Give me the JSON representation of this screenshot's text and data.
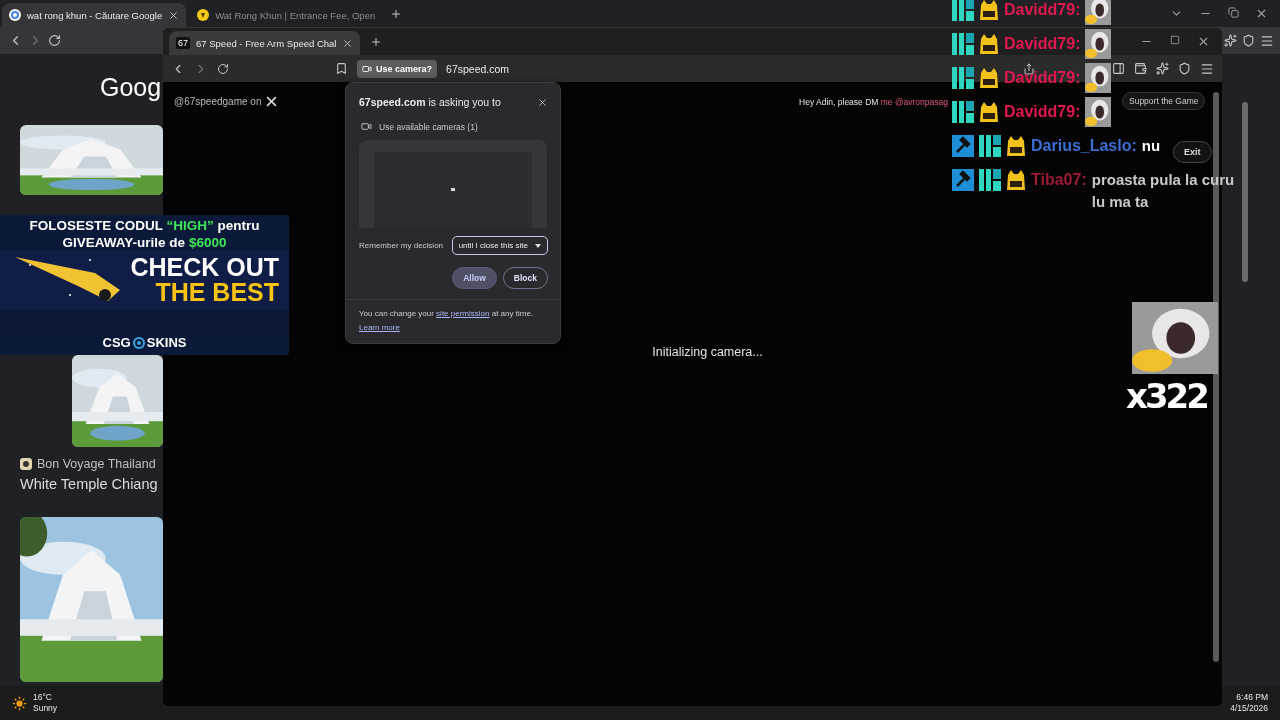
{
  "back_window": {
    "tabs": [
      {
        "title": "wat rong khun - Căutare Google",
        "selected": true
      },
      {
        "title": "Wat Rong Khun | Entrance Fee, Open",
        "selected": false
      }
    ],
    "logo": "Goog",
    "result": {
      "source": "Bon Voyage Thailand",
      "title": "White Temple Chiang"
    }
  },
  "front_window": {
    "tab": {
      "favicon": "67",
      "title": "67 Speed - Free Arm Speed Chal"
    },
    "permission_chip": "Use camera?",
    "url": "67speed.com",
    "page": {
      "social": "@67speedgame on",
      "notice": "Hey Adin, please DM",
      "notice_handle": "me @avronpasag",
      "support_button": "Support the Game",
      "exit_button": "Exit",
      "status": "Initializing camera..."
    }
  },
  "permission_popup": {
    "title": "**67speed.com** is asking you to",
    "permission": "Use available cameras (1)",
    "remember_label": "Remember my decision",
    "duration": "until I close this site",
    "buttons": [
      {
        "label": "Allow",
        "selected": true
      },
      {
        "label": "Block",
        "selected": false
      }
    ],
    "footer_before": "You can change your",
    "footer_link": "site permission",
    "footer_after": "at any time.",
    "learn_more": "Learn more"
  },
  "ad": {
    "line1": [
      {
        "text": "FOLOSESTE CODUL",
        "highlight": false
      },
      {
        "text": "“HIGH”",
        "highlight": true
      },
      {
        "text": "pentru",
        "highlight": false
      }
    ],
    "line2": [
      {
        "text": "GIVEAWAY-urile de",
        "highlight": false
      },
      {
        "text": "$6000",
        "highlight": true
      }
    ],
    "headline": "CHECK OUT",
    "subline": "THE BEST",
    "brand_left": "CSG",
    "brand_right": "SKINS"
  },
  "chat": {
    "messages": [
      {
        "user": "Davidd79:",
        "color": "#e0184e",
        "moderator": false,
        "kind": "emote"
      },
      {
        "user": "Davidd79:",
        "color": "#e0184e",
        "moderator": false,
        "kind": "emote"
      },
      {
        "user": "Davidd79:",
        "color": "#e0184e",
        "moderator": false,
        "kind": "emote"
      },
      {
        "user": "Davidd79:",
        "color": "#e0184e",
        "moderator": false,
        "kind": "emote"
      },
      {
        "user": "Darius_Laslo:",
        "color": "#3c6fd4",
        "moderator": true,
        "kind": "text",
        "text": "nu"
      },
      {
        "user": "Tiba07:",
        "color": "#9c1a34",
        "moderator": true,
        "kind": "text",
        "text": "proasta pula la curu lu ma ta"
      }
    ]
  },
  "emote_combo": {
    "count": "x322"
  },
  "taskbar": {
    "temperature": "16°C",
    "weather": "Sunny",
    "time": "6:46 PM",
    "date": "4/15/2026"
  }
}
